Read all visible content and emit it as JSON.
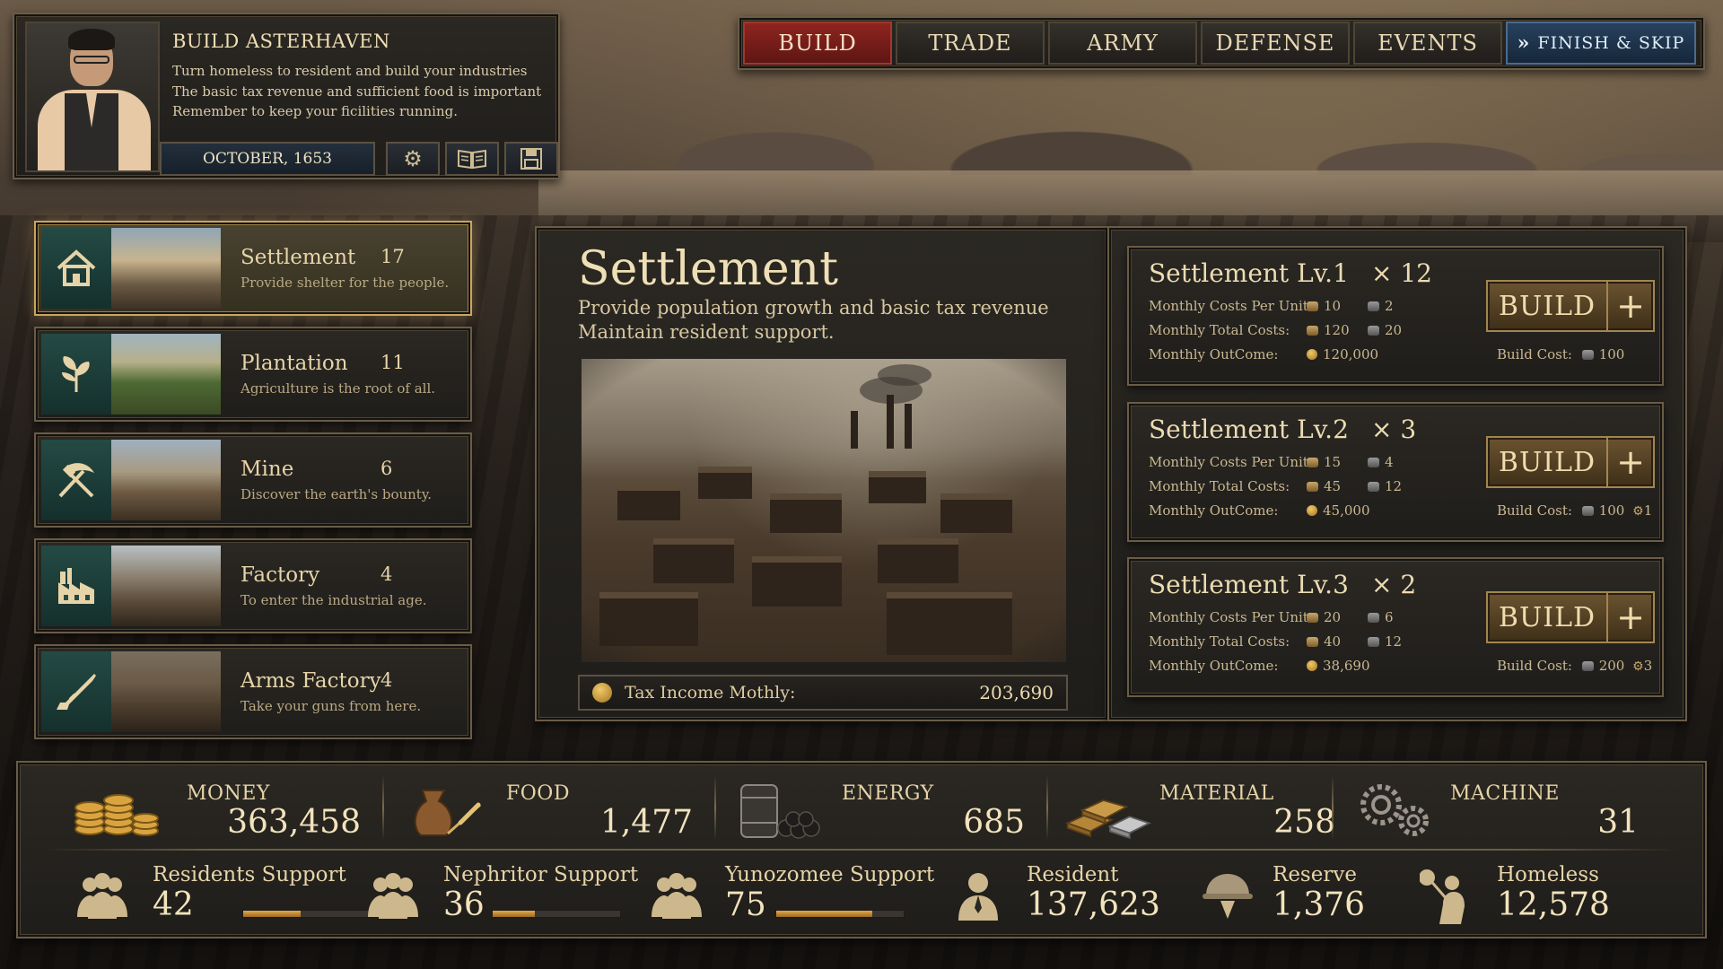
{
  "mission": {
    "title": "BUILD ASTERHAVEN",
    "lines": [
      "Turn homeless to resident and build your industries",
      "The basic tax revenue and sufficient food is important",
      "Remember  to keep your ficilities running."
    ],
    "date": "OCTOBER, 1653",
    "icons": [
      "gear-icon",
      "book-icon",
      "save-icon"
    ]
  },
  "nav": {
    "tabs": [
      "BUILD",
      "TRADE",
      "ARMY",
      "DEFENSE",
      "EVENTS"
    ],
    "active": "BUILD",
    "finish_label": "FINISH & SKIP"
  },
  "categories": [
    {
      "name": "Settlement",
      "count": "17",
      "desc": "Provide shelter for the people.",
      "icon": "house-icon",
      "selected": true
    },
    {
      "name": "Plantation",
      "count": "11",
      "desc": "Agriculture is the root of all.",
      "icon": "leaf-icon",
      "selected": false
    },
    {
      "name": "Mine",
      "count": "6",
      "desc": "Discover the earth's bounty.",
      "icon": "pickaxe-icon",
      "selected": false
    },
    {
      "name": "Factory",
      "count": "4",
      "desc": "To enter the industrial age.",
      "icon": "factory-icon",
      "selected": false
    },
    {
      "name": "Arms Factory",
      "count": "4",
      "desc": "Take your guns from here.",
      "icon": "rifle-icon",
      "selected": false
    }
  ],
  "detail": {
    "title": "Settlement",
    "subtitle_lines": [
      "Provide population growth and basic tax revenue",
      "Maintain resident support."
    ],
    "tax_label": "Tax Income Mothly:",
    "tax_value": "203,690"
  },
  "levels": [
    {
      "name": "Settlement Lv.1",
      "count": "× 12",
      "labels": [
        "Monthly Costs Per Unit:",
        "Monthly Total Costs:",
        "Monthly OutCome:"
      ],
      "per_unit": [
        "10",
        "2"
      ],
      "total": [
        "120",
        "20"
      ],
      "outcome": "120,000",
      "build_label": "BUILD",
      "build_cost_label": "Build Cost:",
      "build_cost": "100",
      "build_cost_machine": ""
    },
    {
      "name": "Settlement Lv.2",
      "count": "× 3",
      "labels": [
        "Monthly Costs Per Unit:",
        "Monthly Total Costs:",
        "Monthly OutCome:"
      ],
      "per_unit": [
        "15",
        "4"
      ],
      "total": [
        "45",
        "12"
      ],
      "outcome": "45,000",
      "build_label": "BUILD",
      "build_cost_label": "Build Cost:",
      "build_cost": "100",
      "build_cost_machine": "1"
    },
    {
      "name": "Settlement Lv.3",
      "count": "× 2",
      "labels": [
        "Monthly Costs Per Unit:",
        "Monthly Total Costs:",
        "Monthly OutCome:"
      ],
      "per_unit": [
        "20",
        "6"
      ],
      "total": [
        "40",
        "12"
      ],
      "outcome": "38,690",
      "build_label": "BUILD",
      "build_cost_label": "Build Cost:",
      "build_cost": "200",
      "build_cost_machine": "3"
    }
  ],
  "resources": [
    {
      "name": "MONEY",
      "value": "363,458",
      "icon": "coins-icon"
    },
    {
      "name": "FOOD",
      "value": "1,477",
      "icon": "grain-sack-icon"
    },
    {
      "name": "ENERGY",
      "value": "685",
      "icon": "coal-barrel-icon"
    },
    {
      "name": "MATERIAL",
      "value": "258",
      "icon": "ingots-icon"
    },
    {
      "name": "MACHINE",
      "value": "31",
      "icon": "gears-icon"
    }
  ],
  "stats": [
    {
      "name": "Residents Support",
      "value": "42",
      "icon": "people-icon",
      "level": 0.45
    },
    {
      "name": "Nephritor Support",
      "value": "36",
      "icon": "people-icon",
      "level": 0.33
    },
    {
      "name": "Yunozomee Support",
      "value": "75",
      "icon": "people-icon",
      "level": 0.75
    },
    {
      "name": "Resident",
      "value": "137,623",
      "icon": "person-icon"
    },
    {
      "name": "Reserve",
      "value": "1,376",
      "icon": "helmet-icon"
    },
    {
      "name": "Homeless",
      "value": "12,578",
      "icon": "bindle-icon"
    }
  ]
}
